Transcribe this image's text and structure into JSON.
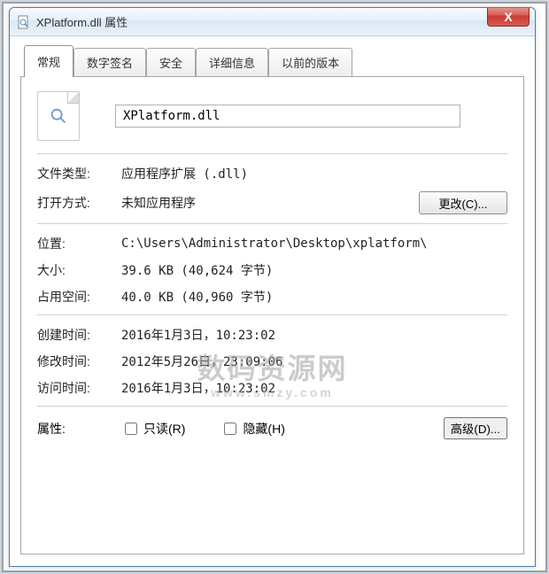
{
  "window": {
    "title": "XPlatform.dll 属性",
    "close_glyph": "X"
  },
  "tabs": [
    {
      "label": "常规",
      "active": true
    },
    {
      "label": "数字签名",
      "active": false
    },
    {
      "label": "安全",
      "active": false
    },
    {
      "label": "详细信息",
      "active": false
    },
    {
      "label": "以前的版本",
      "active": false
    }
  ],
  "general": {
    "filename": "XPlatform.dll",
    "filetype_label": "文件类型:",
    "filetype_value": "应用程序扩展 (.dll)",
    "opens_with_label": "打开方式:",
    "opens_with_value": "未知应用程序",
    "change_button": "更改(C)...",
    "location_label": "位置:",
    "location_value": "C:\\Users\\Administrator\\Desktop\\xplatform\\",
    "size_label": "大小:",
    "size_value": "39.6 KB (40,624 字节)",
    "disk_size_label": "占用空间:",
    "disk_size_value": "40.0 KB (40,960 字节)",
    "created_label": "创建时间:",
    "created_value": "2016年1月3日，10:23:02",
    "modified_label": "修改时间:",
    "modified_value": "2012年5月26日，23:09:06",
    "accessed_label": "访问时间:",
    "accessed_value": "2016年1月3日，10:23:02",
    "attributes_label": "属性:",
    "readonly_label": "只读(R)",
    "hidden_label": "隐藏(H)",
    "advanced_button": "高级(D)...",
    "readonly_checked": false,
    "hidden_checked": false
  },
  "watermark": {
    "text": "数码资源网",
    "sub": "www.smzy.com"
  }
}
